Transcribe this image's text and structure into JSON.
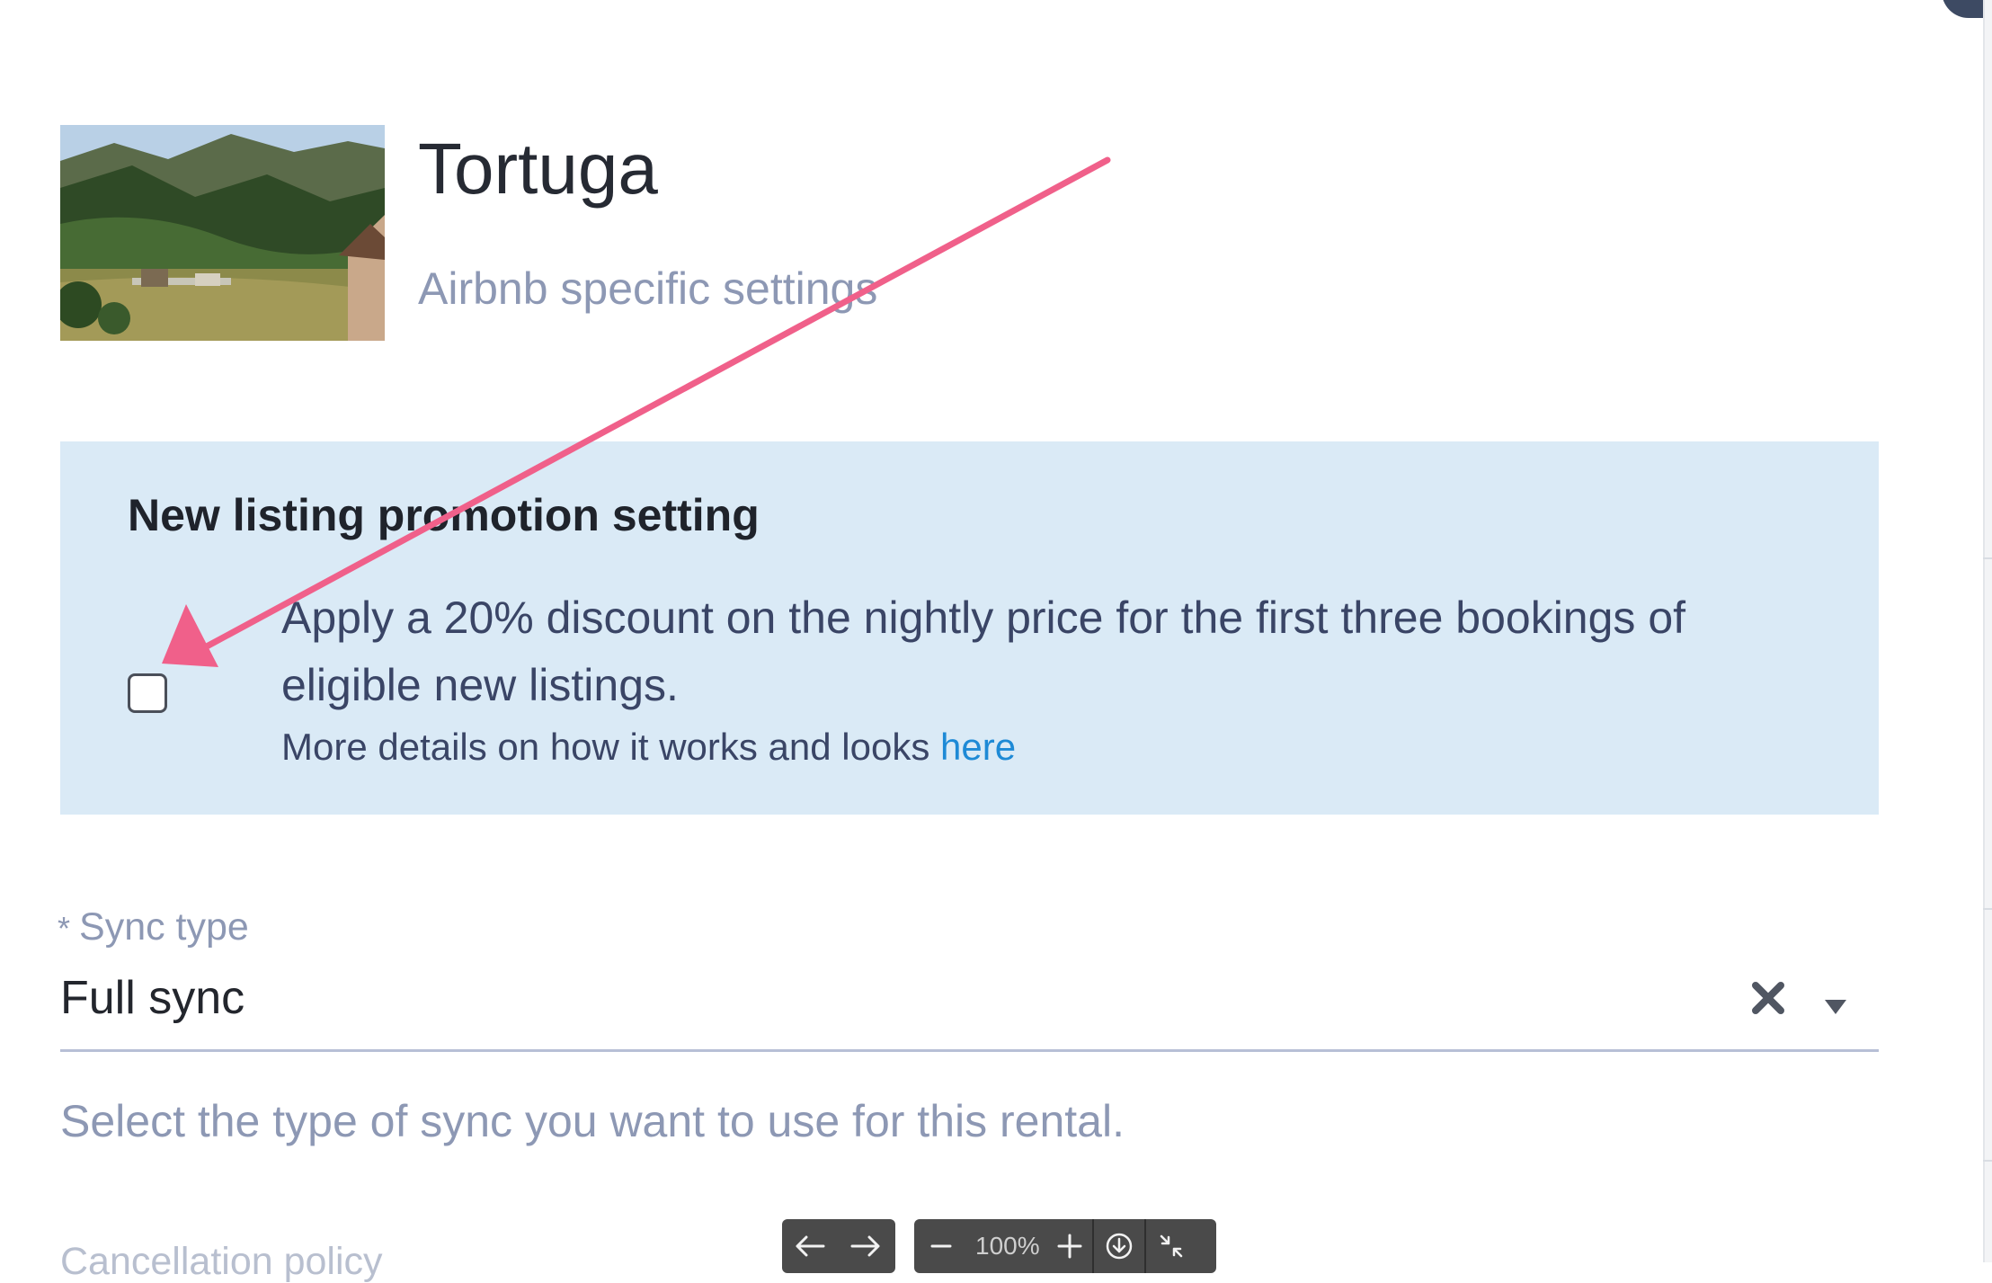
{
  "listing": {
    "name": "Tortuga",
    "subtitle": "Airbnb specific settings"
  },
  "promotion": {
    "heading": "New listing promotion setting",
    "description": "Apply a 20% discount on the nightly price for the first three bookings of eligible new listings.",
    "details_text": "More details on how it works and looks",
    "details_link": "here",
    "checked": false
  },
  "sync": {
    "required_marker": "*",
    "label": "Sync type",
    "value": "Full sync",
    "help": "Select the type of sync you want to use for this rental."
  },
  "next_field_label": "Cancellation policy",
  "viewer_toolbar": {
    "zoom": "100%"
  },
  "colors": {
    "panel_bg": "#daeaf6",
    "link": "#1e8ad6",
    "annotation_arrow": "#f0608a"
  }
}
